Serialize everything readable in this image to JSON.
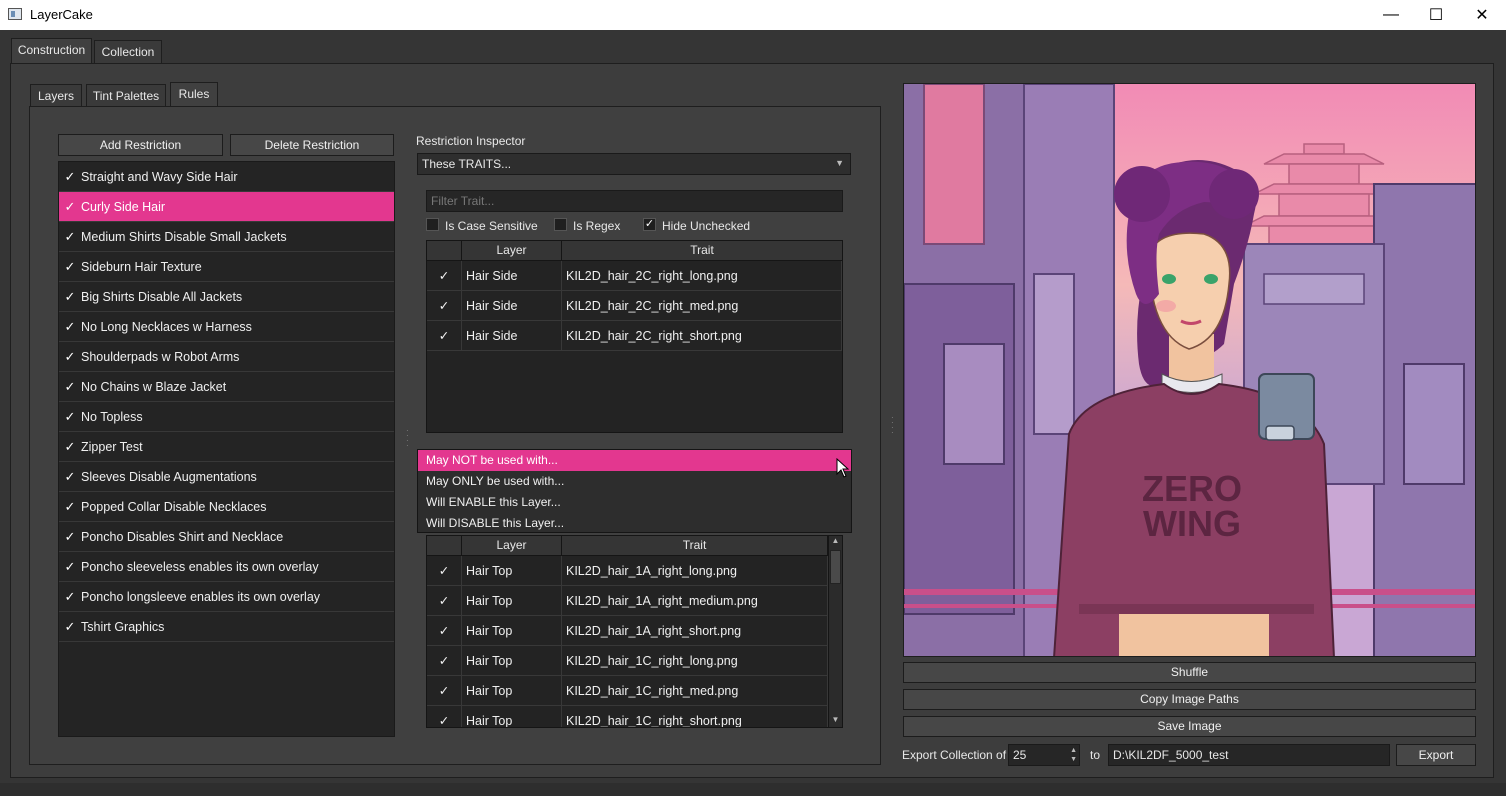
{
  "window": {
    "title": "LayerCake",
    "minimize": "—",
    "maximize": "☐",
    "close": "✕"
  },
  "main_tabs": [
    {
      "label": "Construction"
    },
    {
      "label": "Collection"
    }
  ],
  "sub_tabs": [
    {
      "label": "Layers"
    },
    {
      "label": "Tint Palettes"
    },
    {
      "label": "Rules"
    }
  ],
  "buttons": {
    "add_restriction": "Add Restriction",
    "delete_restriction": "Delete Restriction"
  },
  "restrictions": [
    {
      "label": "Straight and Wavy Side Hair",
      "checked": true,
      "selected": false
    },
    {
      "label": "Curly Side Hair",
      "checked": true,
      "selected": true
    },
    {
      "label": "Medium Shirts Disable Small Jackets",
      "checked": true,
      "selected": false
    },
    {
      "label": "Sideburn Hair Texture",
      "checked": true,
      "selected": false
    },
    {
      "label": "Big Shirts Disable All Jackets",
      "checked": true,
      "selected": false
    },
    {
      "label": "No Long Necklaces w Harness",
      "checked": true,
      "selected": false
    },
    {
      "label": "Shoulderpads w Robot Arms",
      "checked": true,
      "selected": false
    },
    {
      "label": "No Chains w Blaze Jacket",
      "checked": true,
      "selected": false
    },
    {
      "label": "No Topless",
      "checked": true,
      "selected": false
    },
    {
      "label": "Zipper Test",
      "checked": true,
      "selected": false
    },
    {
      "label": "Sleeves Disable Augmentations",
      "checked": true,
      "selected": false
    },
    {
      "label": "Popped Collar Disable Necklaces",
      "checked": true,
      "selected": false
    },
    {
      "label": "Poncho Disables Shirt and Necklace",
      "checked": true,
      "selected": false
    },
    {
      "label": "Poncho sleeveless enables its own overlay",
      "checked": true,
      "selected": false
    },
    {
      "label": "Poncho longsleeve enables its own overlay",
      "checked": true,
      "selected": false
    },
    {
      "label": "Tshirt Graphics",
      "checked": true,
      "selected": false
    }
  ],
  "inspector": {
    "title": "Restriction Inspector",
    "selector_value": "These TRAITS...",
    "filter_placeholder": "Filter Trait...",
    "options": {
      "case_sensitive": "Is Case Sensitive",
      "is_regex": "Is Regex",
      "hide_unchecked": "Hide Unchecked"
    },
    "columns": {
      "layer": "Layer",
      "trait": "Trait"
    },
    "top_rows": [
      {
        "checked": "✓",
        "layer": "Hair Side",
        "trait": "KIL2D_hair_2C_right_long.png"
      },
      {
        "checked": "✓",
        "layer": "Hair Side",
        "trait": "KIL2D_hair_2C_right_med.png"
      },
      {
        "checked": "✓",
        "layer": "Hair Side",
        "trait": "KIL2D_hair_2C_right_short.png"
      }
    ],
    "dropdown_options": [
      {
        "label": "May NOT be used with...",
        "selected": true
      },
      {
        "label": "May ONLY be used with...",
        "selected": false
      },
      {
        "label": "Will ENABLE this Layer...",
        "selected": false
      },
      {
        "label": "Will DISABLE this Layer...",
        "selected": false
      }
    ],
    "bottom_rows": [
      {
        "checked": "✓",
        "layer": "Hair Top",
        "trait": "KIL2D_hair_1A_right_long.png"
      },
      {
        "checked": "✓",
        "layer": "Hair Top",
        "trait": "KIL2D_hair_1A_right_medium.png"
      },
      {
        "checked": "✓",
        "layer": "Hair Top",
        "trait": "KIL2D_hair_1A_right_short.png"
      },
      {
        "checked": "✓",
        "layer": "Hair Top",
        "trait": "KIL2D_hair_1C_right_long.png"
      },
      {
        "checked": "✓",
        "layer": "Hair Top",
        "trait": "KIL2D_hair_1C_right_med.png"
      },
      {
        "checked": "✓",
        "layer": "Hair Top",
        "trait": "KIL2D_hair_1C_right_short.png"
      }
    ]
  },
  "preview": {
    "shirt_text_line1": "ZERO",
    "shirt_text_line2": "WING"
  },
  "actions": {
    "shuffle": "Shuffle",
    "copy_paths": "Copy Image Paths",
    "save_image": "Save Image"
  },
  "export": {
    "label": "Export Collection of",
    "count": "25",
    "to": "to",
    "path": "D:\\KIL2DF_5000_test",
    "button": "Export"
  },
  "colors": {
    "accent": "#e3378f"
  }
}
